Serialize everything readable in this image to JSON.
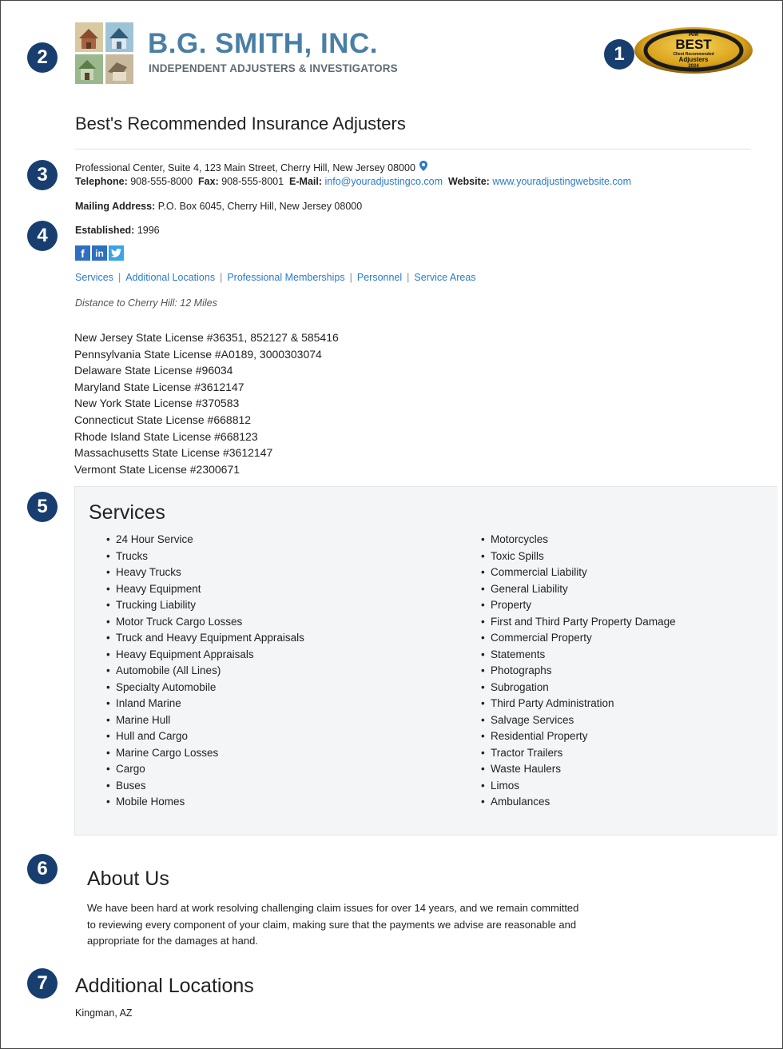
{
  "markers": [
    "1",
    "2",
    "3",
    "4",
    "5",
    "6",
    "7"
  ],
  "brand": {
    "name": "B.G. SMITH, INC.",
    "tagline": "INDEPENDENT ADJUSTERS & INVESTIGATORS",
    "badge": {
      "top": "AM",
      "main": "BEST",
      "line1": "Client Recommended",
      "line2": "Adjusters",
      "year": "2024"
    }
  },
  "page_title": "Best's Recommended Insurance Adjusters",
  "contact": {
    "address": "Professional Center, Suite 4, 123 Main Street, Cherry Hill, New Jersey 08000",
    "telephone_label": "Telephone:",
    "telephone": "908-555-8000",
    "fax_label": "Fax:",
    "fax": "908-555-8001",
    "email_label": "E-Mail:",
    "email": "info@youradjustingco.com",
    "website_label": "Website:",
    "website": "www.youradjustingwebsite.com",
    "mailing_label": "Mailing Address:",
    "mailing": "P.O. Box 6045, Cherry Hill, New Jersey 08000",
    "established_label": "Established:",
    "established": "1996"
  },
  "social": {
    "facebook": "f",
    "linkedin": "in",
    "twitter": "t"
  },
  "nav": [
    "Services",
    "Additional Locations",
    "Professional Memberships",
    "Personnel",
    "Service Areas"
  ],
  "distance": "Distance to Cherry Hill: 12 Miles",
  "licenses": [
    "New Jersey State License #36351, 852127 & 585416",
    "Pennsylvania State License #A0189, 3000303074",
    "Delaware State License #96034",
    "Maryland State License #3612147",
    "New York State License #370583",
    "Connecticut State License #668812",
    "Rhode Island State License #668123",
    "Massachusetts State License #3612147",
    "Vermont State License #2300671"
  ],
  "services": {
    "title": "Services",
    "left": [
      "24 Hour Service",
      "Trucks",
      "Heavy Trucks",
      "Heavy Equipment",
      "Trucking Liability",
      "Motor Truck Cargo Losses",
      "Truck and Heavy Equipment Appraisals",
      "Heavy Equipment Appraisals",
      "Automobile (All Lines)",
      "Specialty Automobile",
      "Inland Marine",
      "Marine Hull",
      "Hull and Cargo",
      "Marine Cargo Losses",
      "Cargo",
      "Buses",
      "Mobile Homes"
    ],
    "right": [
      "Motorcycles",
      "Toxic Spills",
      "Commercial Liability",
      "General Liability",
      "Property",
      "First and Third Party Property Damage",
      "Commercial Property",
      "Statements",
      "Photographs",
      "Subrogation",
      "Third Party Administration",
      "Salvage Services",
      "Residential Property",
      "Tractor Trailers",
      "Waste Haulers",
      "Limos",
      "Ambulances"
    ]
  },
  "about": {
    "title": "About Us",
    "text": "We have been hard at work resolving challenging claim issues for over 14 years, and we remain committed to reviewing every component of your claim, making sure that the payments we advise are reasonable and appropriate for the damages at hand."
  },
  "additional_locations": {
    "title": "Additional Locations",
    "items": [
      "Kingman, AZ"
    ]
  },
  "colors": {
    "marker": "#183e6f",
    "brand": "#4a7fa5",
    "link": "#2a7ac8",
    "panel": "#f4f5f6"
  }
}
